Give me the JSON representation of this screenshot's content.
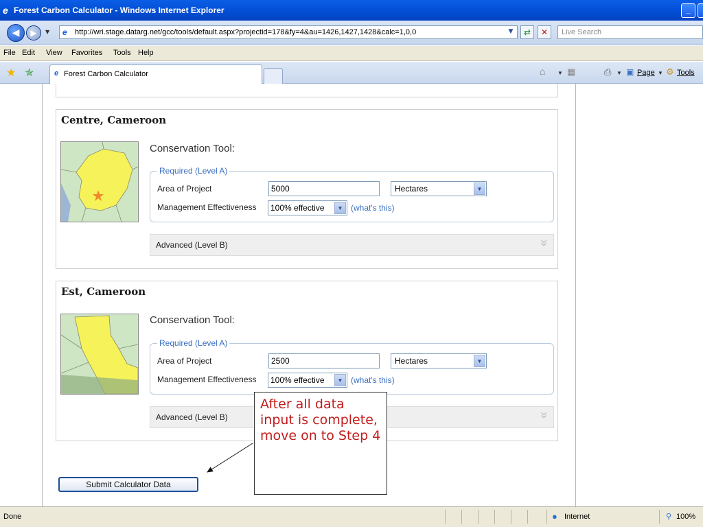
{
  "window": {
    "title": "Forest Carbon Calculator - Windows Internet Explorer"
  },
  "address": {
    "url": "http://wri.stage.datarg.net/gcc/tools/default.aspx?projectid=178&fy=4&au=1426,1427,1428&calc=1,0,0",
    "search_placeholder": "Live Search"
  },
  "menu": [
    "File",
    "Edit",
    "View",
    "Favorites",
    "Tools",
    "Help"
  ],
  "tab": {
    "label": "Forest Carbon Calculator"
  },
  "toolbar": {
    "page_label": "Page",
    "tools_label": "Tools"
  },
  "panels": [
    {
      "region": "Centre, Cameroon",
      "tool_title": "Conservation Tool:",
      "required_legend": "Required (Level A)",
      "area_label": "Area of Project",
      "area_value": "5000",
      "unit_value": "Hectares",
      "mgmt_label": "Management Effectiveness",
      "mgmt_value": "100% effective",
      "help_link": "(what's this)",
      "advanced_label": "Advanced (Level B)"
    },
    {
      "region": "Est, Cameroon",
      "tool_title": "Conservation Tool:",
      "required_legend": "Required (Level A)",
      "area_label": "Area of Project",
      "area_value": "2500",
      "unit_value": "Hectares",
      "mgmt_label": "Management Effectiveness",
      "mgmt_value": "100% effective",
      "help_link": "(what's this)",
      "advanced_label": "Advanced (Level B)"
    }
  ],
  "submit": {
    "label": "Submit Calculator Data"
  },
  "callout": {
    "text": "After all data input is complete, move on to Step 4"
  },
  "status": {
    "left": "Done",
    "zone": "Internet",
    "zoom": "100%"
  }
}
